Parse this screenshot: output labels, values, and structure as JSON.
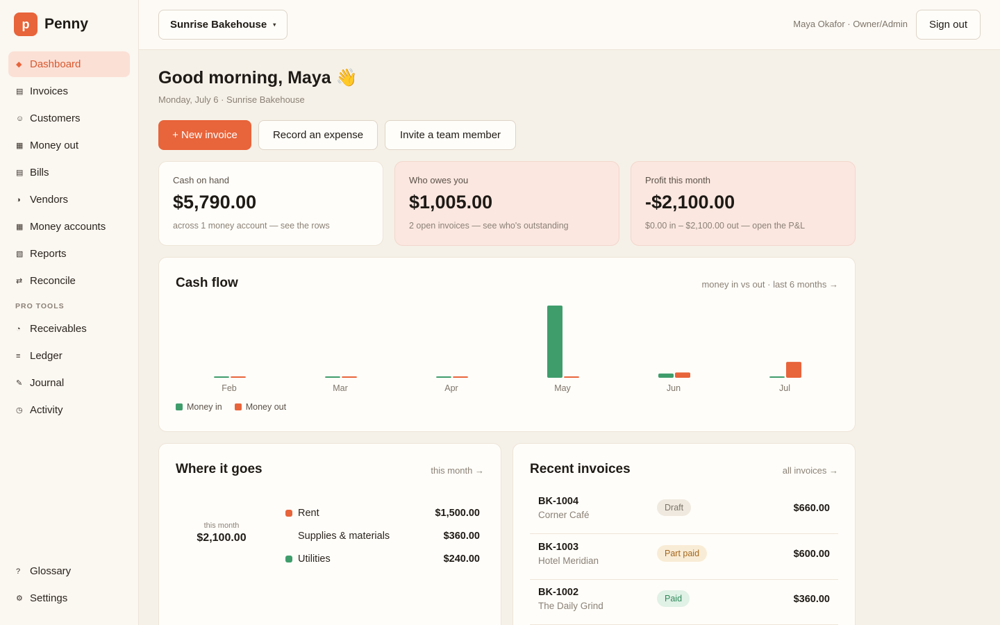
{
  "brand": {
    "logo_letter": "p",
    "name": "Penny",
    "accent": "#e8643a"
  },
  "sidebar": {
    "items": [
      {
        "label": "Dashboard",
        "icon": "◆",
        "icon_name": "diamond-icon",
        "active": true
      },
      {
        "label": "Invoices",
        "icon": "▤",
        "icon_name": "invoice-icon"
      },
      {
        "label": "Customers",
        "icon": "☺",
        "icon_name": "customer-icon"
      },
      {
        "label": "Money out",
        "icon": "▦",
        "icon_name": "money-out-icon"
      },
      {
        "label": "Bills",
        "icon": "▤",
        "icon_name": "bill-icon"
      },
      {
        "label": "Vendors",
        "icon": "◑",
        "icon_name": "vendor-icon"
      },
      {
        "label": "Money accounts",
        "icon": "▦",
        "icon_name": "bank-icon"
      },
      {
        "label": "Reports",
        "icon": "▧",
        "icon_name": "report-icon"
      },
      {
        "label": "Reconcile",
        "icon": "⇄",
        "icon_name": "reconcile-icon"
      }
    ],
    "section_label": "PRO TOOLS",
    "pro_items": [
      {
        "label": "Receivables",
        "icon": "◔",
        "icon_name": "receivables-icon"
      },
      {
        "label": "Ledger",
        "icon": "≡",
        "icon_name": "ledger-icon"
      },
      {
        "label": "Journal",
        "icon": "✎",
        "icon_name": "journal-icon"
      },
      {
        "label": "Activity",
        "icon": "◷",
        "icon_name": "activity-icon"
      }
    ],
    "bottom_items": [
      {
        "label": "Glossary",
        "icon": "?",
        "icon_name": "glossary-icon"
      },
      {
        "label": "Settings",
        "icon": "⚙",
        "icon_name": "settings-icon"
      }
    ]
  },
  "topbar": {
    "business": "Sunrise Bakehouse",
    "caret": "▾",
    "user": "Maya Okafor · Owner/Admin",
    "sign_out": "Sign out"
  },
  "header": {
    "greeting": "Good morning, Maya 👋",
    "subtitle": "Monday, July 6 · Sunrise Bakehouse"
  },
  "actions": {
    "new_invoice": "+ New invoice",
    "record_expense": "Record an expense",
    "invite": "Invite a team member"
  },
  "stats": [
    {
      "label": "Cash on hand",
      "value": "$5,790.00",
      "note": "across 1 money account — see the rows"
    },
    {
      "label": "Who owes you",
      "value": "$1,005.00",
      "note": "2 open invoices — see who's outstanding"
    },
    {
      "label": "Profit this month",
      "value": "-$2,100.00",
      "note": "$0.00 in – $2,100.00 out — open the P&L"
    }
  ],
  "cashflow": {
    "title": "Cash flow",
    "link": "money in vs out · last 6 months →",
    "legend_in": "Money in",
    "legend_out": "Money out",
    "color_in": "#3f9d6c",
    "color_out": "#e8643a"
  },
  "chart_data": {
    "type": "bar",
    "categories": [
      "Feb",
      "Mar",
      "Apr",
      "May",
      "Jun",
      "Jul"
    ],
    "series": [
      {
        "name": "Money in",
        "values": [
          0,
          0,
          0,
          20500,
          1200,
          0
        ]
      },
      {
        "name": "Money out",
        "values": [
          0,
          0,
          0,
          0,
          1500,
          4500
        ]
      }
    ],
    "ylim": [
      0,
      20500
    ],
    "grid": false,
    "legend": "bottom-left"
  },
  "where_it_goes": {
    "title": "Where it goes",
    "link": "this month →",
    "center_label": "this month",
    "center_total": "$2,100.00",
    "categories": [
      {
        "name": "Rent",
        "amount": "$1,500.00",
        "color": "#e8643a"
      },
      {
        "name": "Supplies & materials",
        "amount": "$360.00",
        "color": ""
      },
      {
        "name": "Utilities",
        "amount": "$240.00",
        "color": "#3f9d6c"
      }
    ]
  },
  "recent_invoices": {
    "title": "Recent invoices",
    "link": "all invoices →",
    "rows": [
      {
        "id": "BK-1004",
        "customer": "Corner Café",
        "status": "Draft",
        "amount": "$660.00",
        "badge_bg": "#efe9df",
        "badge_fg": "#7d7469"
      },
      {
        "id": "BK-1003",
        "customer": "Hotel Meridian",
        "status": "Part paid",
        "amount": "$600.00",
        "badge_bg": "#f9ecd6",
        "badge_fg": "#a4661c"
      },
      {
        "id": "BK-1002",
        "customer": "The Daily Grind",
        "status": "Paid",
        "amount": "$360.00",
        "badge_bg": "#e0f1e6",
        "badge_fg": "#2f8a5a"
      }
    ]
  }
}
